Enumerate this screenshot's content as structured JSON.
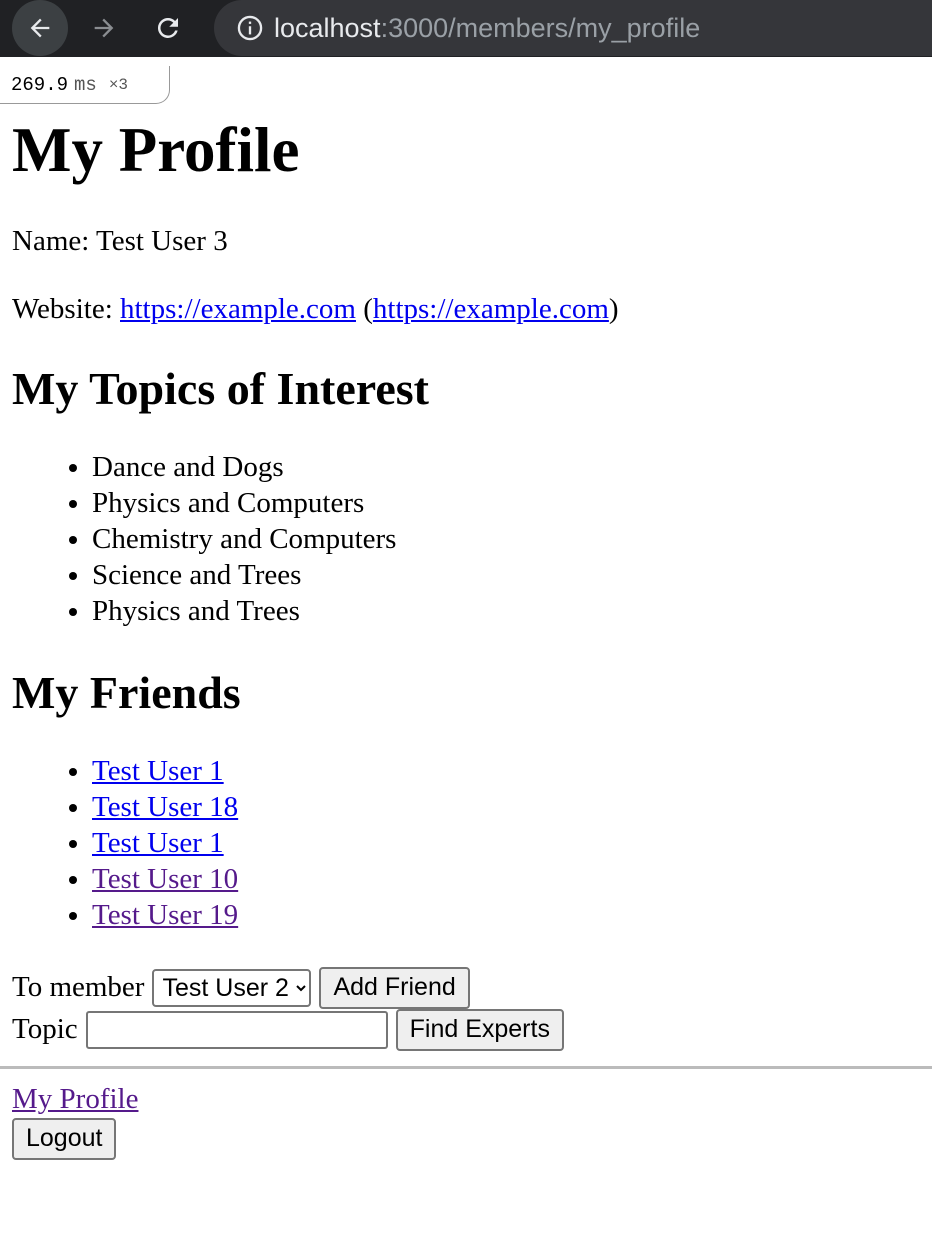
{
  "browser": {
    "url_host": "localhost",
    "url_path": ":3000/members/my_profile",
    "icons": [
      "back-arrow-icon",
      "forward-arrow-icon",
      "reload-icon",
      "info-icon"
    ]
  },
  "timing": {
    "value": "269.9",
    "unit": "ms",
    "count": "×3"
  },
  "page": {
    "title": "My Profile",
    "name_label": "Name: Test User 3",
    "website_label": "Website:",
    "website_link": "https://example.com",
    "website_paren_link": "https://example.com",
    "topics_heading": "My Topics of Interest",
    "topics": [
      "Dance and Dogs",
      "Physics and Computers",
      "Chemistry and Computers",
      "Science and Trees",
      "Physics and Trees"
    ],
    "friends_heading": "My Friends",
    "friends": [
      {
        "name": "Test User 1",
        "visited": false
      },
      {
        "name": "Test User 18",
        "visited": false
      },
      {
        "name": "Test User 1",
        "visited": false
      },
      {
        "name": "Test User 10",
        "visited": true
      },
      {
        "name": "Test User 19",
        "visited": true
      }
    ],
    "to_member_label": "To member",
    "to_member_selected": "Test User 2",
    "add_friend_label": "Add Friend",
    "topic_label": "Topic",
    "topic_value": "",
    "find_experts_label": "Find Experts",
    "footer_link": "My Profile",
    "logout_label": "Logout"
  }
}
